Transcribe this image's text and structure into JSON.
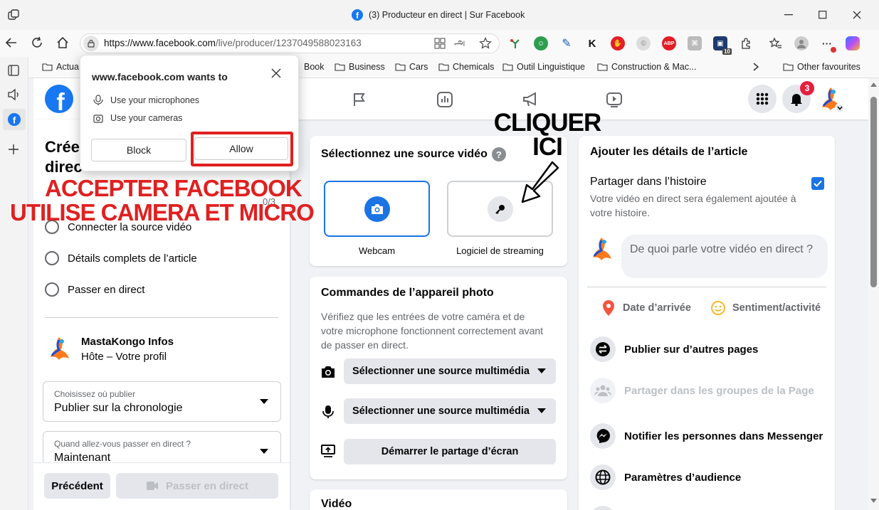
{
  "browser": {
    "tab_title": "(3) Producteur en direct | Sur Facebook",
    "url_prefix": "https://www.facebook.com",
    "url_path": "/live/producer/1237049588023163",
    "ext_badge_abp": "ABP",
    "ext_badge_k": "K",
    "ext_badge_count": "10",
    "bookmarks": [
      "Actua",
      "Book",
      "Business",
      "Cars",
      "Chemicals",
      "Outil Linguistique",
      "Construction & Mac..."
    ],
    "other_favourites": "Other favourites"
  },
  "permission_popup": {
    "title": "www.facebook.com wants to",
    "item_mic": "Use your microphones",
    "item_cam": "Use your cameras",
    "block_label": "Block",
    "allow_label": "Allow"
  },
  "annotations": {
    "cliquer_line1": "CLIQUER",
    "cliquer_line2": "ICI",
    "accept_line1": "ACCEPTER FACEBOOK",
    "accept_line2": "UTILISE CAMERA ET MICRO"
  },
  "fb": {
    "notif_count": "3",
    "left": {
      "title_partial_1": "Crée",
      "title_partial_2": "direc",
      "step_counter": "0/3",
      "steps": [
        "Connecter la source vidéo",
        "Détails complets de l’article",
        "Passer en direct"
      ],
      "profile_name": "MastaKongo Infos",
      "profile_role": "Hôte – Votre profil",
      "publish_label": "Choisissez où publier",
      "publish_value": "Publier sur la chronologie",
      "when_label": "Quand allez-vous passer en direct ?",
      "when_value": "Maintenant",
      "prev_button": "Précédent",
      "golive_button": "Passer en direct"
    },
    "middle": {
      "source_title": "Sélectionnez une source vidéo",
      "source_webcam": "Webcam",
      "source_software": "Logiciel de streaming",
      "camera_title": "Commandes de l’appareil photo",
      "camera_desc": "Vérifiez que les entrées de votre caméra et de votre microphone fonctionnent correctement avant de passer en direct.",
      "select_cam": "Sélectionner une source multimédia",
      "select_mic": "Sélectionner une source multimédia",
      "screen_share": "Démarrer le partage d’écran",
      "video_title": "Vidéo"
    },
    "right": {
      "title": "Ajouter les détails de l’article",
      "share_story_title": "Partager dans l’histoire",
      "share_story_desc": "Votre vidéo en direct sera également ajoutée à votre histoire.",
      "composer_placeholder": "De quoi parle votre vidéo en direct ?",
      "date_label": "Date d’arrivée",
      "feeling_label": "Sentiment/activité",
      "options": [
        "Publier sur d’autres pages",
        "Partager dans les groupes de la Page",
        "Notifier les personnes dans Messenger",
        "Paramètres d’audience"
      ]
    }
  }
}
